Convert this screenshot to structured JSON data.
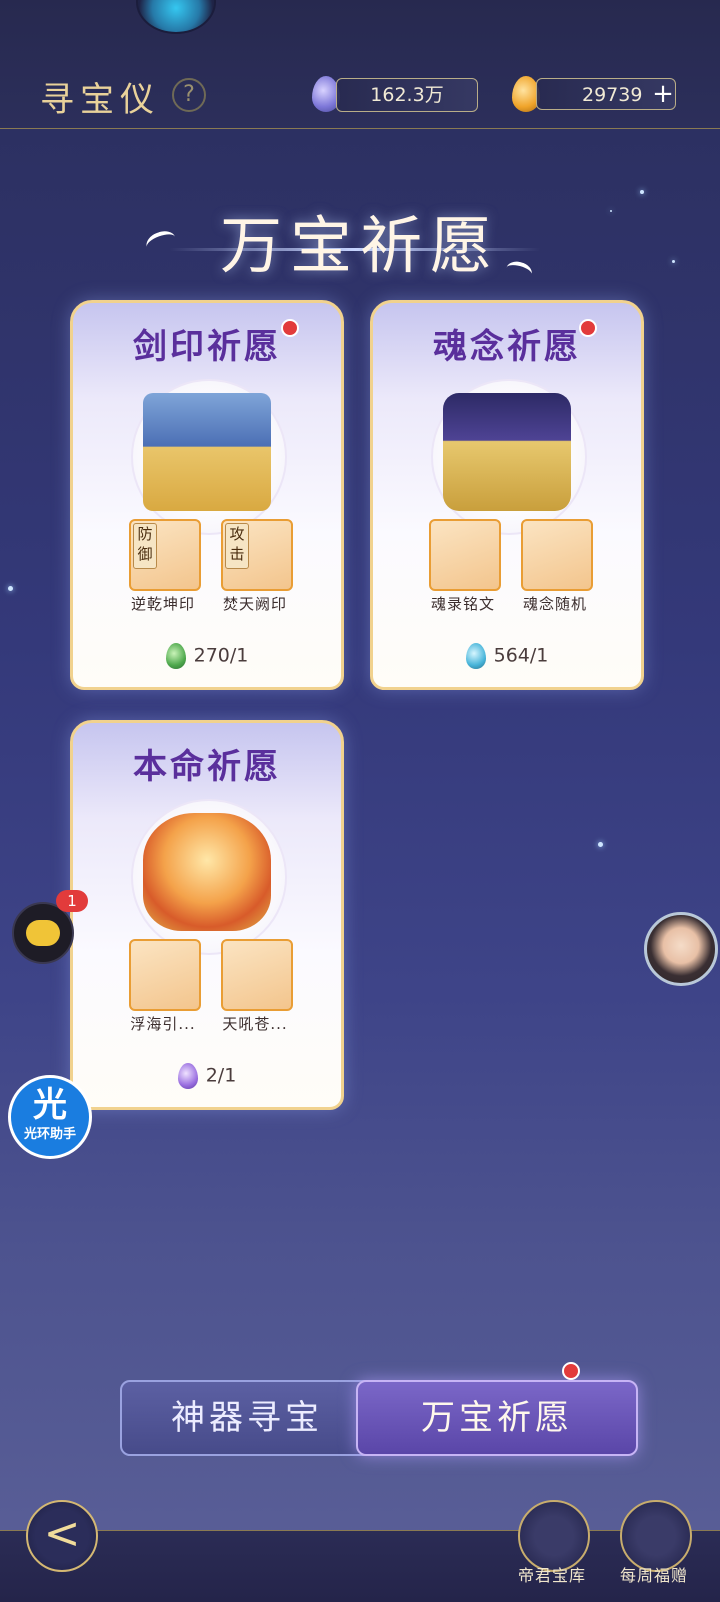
{
  "header": {
    "title": "寻宝仪",
    "help_icon": "?",
    "currency_1": {
      "icon": "blue-feather-gem-icon",
      "value": "162.3万"
    },
    "currency_2": {
      "icon": "orange-feather-gem-icon",
      "value": "29739",
      "add_label": "+"
    }
  },
  "banner": {
    "title": "万宝祈愿"
  },
  "cards": [
    {
      "title": "剑印祈愿",
      "items": [
        {
          "tag": "防御",
          "label": "逆乾坤印"
        },
        {
          "tag": "攻击",
          "label": "焚天阙印"
        }
      ],
      "cost": "270/1"
    },
    {
      "title": "魂念祈愿",
      "items": [
        {
          "tag": "",
          "label": "魂录铭文"
        },
        {
          "tag": "",
          "label": "魂念随机"
        }
      ],
      "cost": "564/1"
    },
    {
      "title": "本命祈愿",
      "items": [
        {
          "tag": "",
          "label": "浮海引..."
        },
        {
          "tag": "",
          "label": "天吼苍..."
        }
      ],
      "cost": "2/1"
    }
  ],
  "side": {
    "chat_badge": "1",
    "helper_big": "光",
    "helper_small": "光环助手"
  },
  "tabs": {
    "inactive_label": "神器寻宝",
    "active_label": "万宝祈愿"
  },
  "bottom_nav": {
    "back_icon": "<",
    "btn1_label": "帝君宝库",
    "btn2_label": "每周福赠"
  },
  "colors": {
    "accent_gold": "#e9d29a",
    "card_title": "#5a2f9c",
    "badge_red": "#e23b3b"
  }
}
